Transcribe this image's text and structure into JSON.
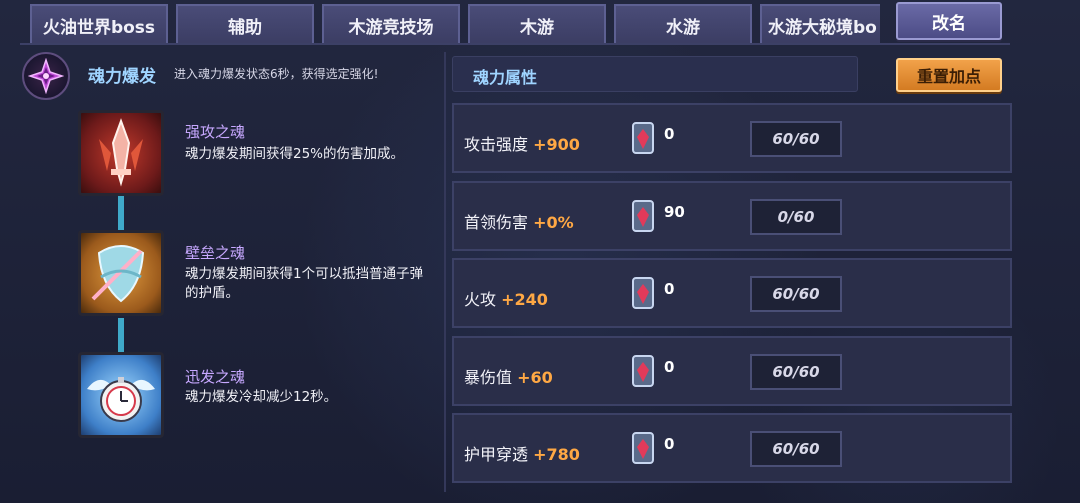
{
  "tabs": [
    {
      "label": "火油世界boss"
    },
    {
      "label": "辅助"
    },
    {
      "label": "木游竞技场"
    },
    {
      "label": "木游"
    },
    {
      "label": "水游"
    },
    {
      "label": "水游大秘境bo"
    }
  ],
  "rename_label": "改名",
  "burst": {
    "title": "魂力爆发",
    "description": "进入魂力爆发状态6秒，获得选定强化!"
  },
  "talents": [
    {
      "name": "强攻之魂",
      "description": "魂力爆发期间获得25%的伤害加成。",
      "icon": "flame-sword-icon"
    },
    {
      "name": "壁垒之魂",
      "description": "魂力爆发期间获得1个可以抵挡普通子弹的护盾。",
      "icon": "shield-bow-icon"
    },
    {
      "name": "迅发之魂",
      "description": "魂力爆发冷却减少12秒。",
      "icon": "clock-wings-icon"
    }
  ],
  "attributes": {
    "header": "魂力属性",
    "reset_label": "重置加点",
    "rows": [
      {
        "label": "攻击强度",
        "bonus": "+900",
        "gems": "0",
        "level": "60/60"
      },
      {
        "label": "首领伤害",
        "bonus": "+0%",
        "gems": "90",
        "level": "0/60"
      },
      {
        "label": "火攻",
        "bonus": "+240",
        "gems": "0",
        "level": "60/60"
      },
      {
        "label": "暴伤值",
        "bonus": "+60",
        "gems": "0",
        "level": "60/60"
      },
      {
        "label": "护甲穿透",
        "bonus": "+780",
        "gems": "0",
        "level": "60/60"
      }
    ]
  },
  "colors": {
    "accent_blue": "#9fd4ff",
    "talent_name": "#c7a8ff",
    "bonus_orange": "#ffa844",
    "reset_orange": "#e08c32"
  }
}
